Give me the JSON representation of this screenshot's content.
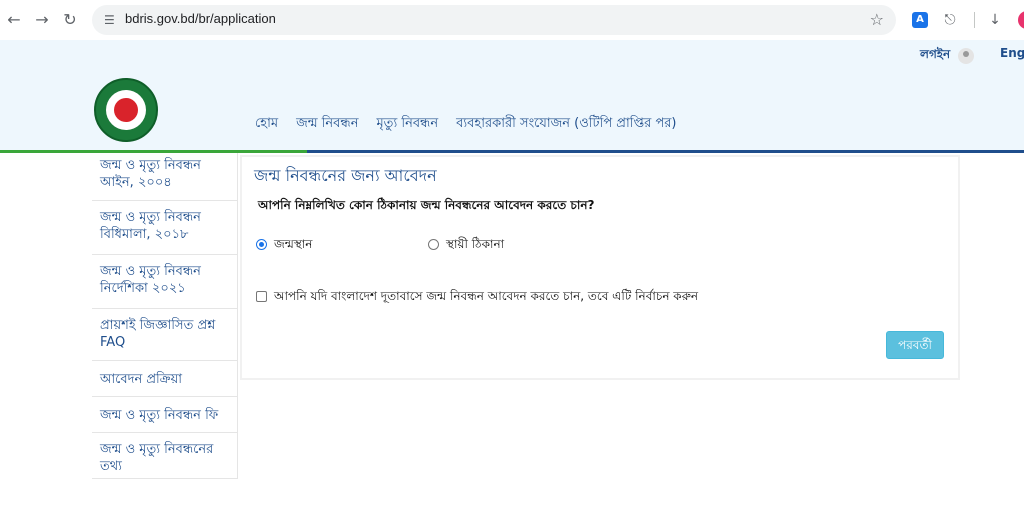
{
  "browser": {
    "url": "bdris.gov.bd/br/application",
    "icons": [
      "back-icon",
      "forward-icon",
      "reload-icon",
      "site-info-icon",
      "bookmark-star-icon",
      "translate-icon",
      "extensions-icon",
      "download-icon",
      "profile-avatar"
    ]
  },
  "header": {
    "login_label": "লগইন",
    "language_label": "Engl",
    "nav": [
      "হোম",
      "জন্ম নিবন্ধন",
      "মৃত্যু নিবন্ধন",
      "ব্যবহারকারী সংযোজন (ওটিপি প্রাপ্তির পর)"
    ]
  },
  "sidebar": {
    "items": [
      {
        "label": "জন্ম ও মৃত্যু নিবন্ধন আইন, ২০০৪"
      },
      {
        "label": "জন্ম ও মৃত্যু নিবন্ধন বিধিমালা, ২০১৮"
      },
      {
        "label": "জন্ম ও মৃত্যু নিবন্ধন নির্দেশিকা ২০২১"
      },
      {
        "label": "প্রায়শই জিজ্ঞাসিত প্রশ্ন FAQ"
      },
      {
        "label": "আবেদন প্রক্রিয়া"
      },
      {
        "label": "জন্ম ও মৃত্যু নিবন্ধন ফি"
      },
      {
        "label": "জন্ম ও মৃত্যু নিবন্ধনের তথ্য"
      }
    ]
  },
  "form": {
    "title": "জন্ম নিবন্ধনের জন্য আবেদন",
    "question": "আপনি নিম্নলিখিত কোন ঠিকানায় জন্ম নিবন্ধনের আবেদন করতে চান?",
    "options": [
      {
        "label": "জন্মস্থান",
        "selected": true
      },
      {
        "label": "স্থায়ী ঠিকানা",
        "selected": false
      }
    ],
    "embassy_checkbox_label": "আপনি যদি বাংলাদেশ দূতাবাসে জন্ম নিবন্ধন আবেদন করতে চান, তবে এটি নির্বাচন করুন",
    "embassy_checked": false,
    "next_label": "পরবর্তী"
  },
  "colors": {
    "link": "#1f4e8c",
    "header_bg": "#eef7fd",
    "accent_green": "#3aa63a",
    "button": "#5bc0de"
  }
}
